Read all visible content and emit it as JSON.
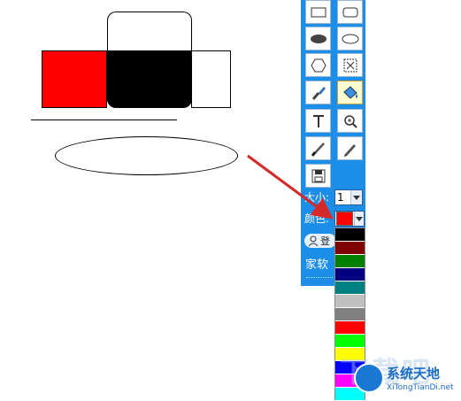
{
  "panel": {
    "size_label": "大小:",
    "size_value": "1",
    "color_label": "颜色:",
    "color_value": "#ff0000",
    "user_label": "登",
    "bottom_link": "家软"
  },
  "tools": [
    {
      "name": "rectangle-tool",
      "icon": "rectangle-icon"
    },
    {
      "name": "rounded-rectangle-tool",
      "icon": "rounded-rectangle-icon"
    },
    {
      "name": "filled-ellipse-tool",
      "icon": "filled-ellipse-icon"
    },
    {
      "name": "ellipse-tool",
      "icon": "ellipse-icon"
    },
    {
      "name": "polygon-tool",
      "icon": "hexagon-icon"
    },
    {
      "name": "select-tool",
      "icon": "select-icon"
    },
    {
      "name": "brush-tool",
      "icon": "brush-icon"
    },
    {
      "name": "fill-tool",
      "icon": "paint-bucket-icon",
      "selected": true
    },
    {
      "name": "text-tool",
      "icon": "text-icon"
    },
    {
      "name": "zoom-tool",
      "icon": "magnifier-icon"
    },
    {
      "name": "paintbrush-tool",
      "icon": "paintbrush-icon"
    },
    {
      "name": "pencil-tool",
      "icon": "pencil-icon"
    },
    {
      "name": "save-tool",
      "icon": "save-icon"
    }
  ],
  "color_options": [
    "#000000",
    "#800000",
    "#008000",
    "#000080",
    "#008080",
    "#c0c0c0",
    "#808080",
    "#ff0000",
    "#00ff00",
    "#ffff00",
    "#0000ff",
    "#ff00ff",
    "#00ffff"
  ],
  "watermark": {
    "title": "系统天地",
    "subtitle": "XiTongTianDi.net",
    "faint": "下载吧"
  },
  "colors": {
    "panel_bg": "#1d8ee7",
    "arrow": "#d42a2a"
  }
}
